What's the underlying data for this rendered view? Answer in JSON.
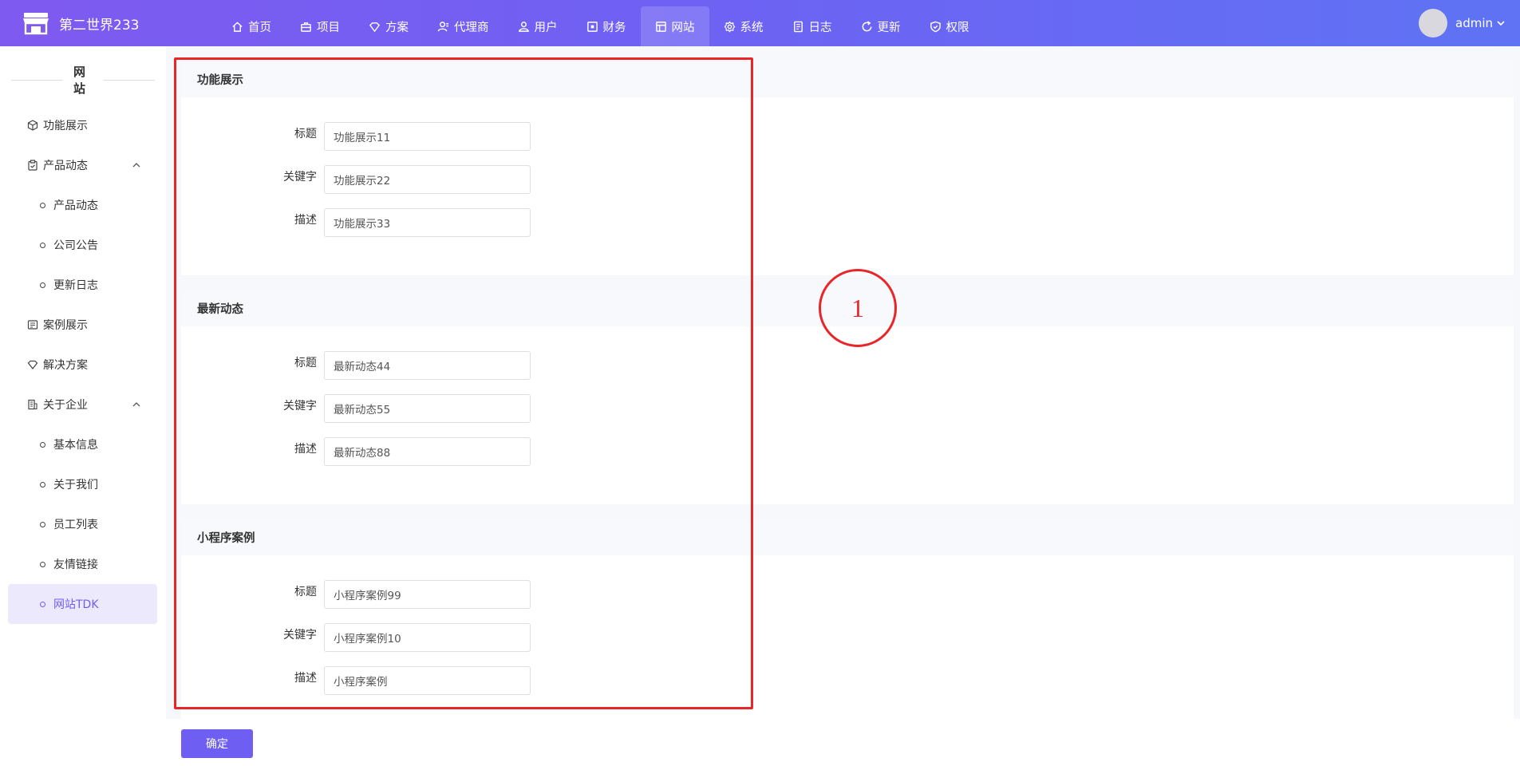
{
  "header": {
    "brand": "第二世界233",
    "nav": [
      {
        "label": "首页",
        "icon": "home-icon"
      },
      {
        "label": "项目",
        "icon": "briefcase-icon"
      },
      {
        "label": "方案",
        "icon": "diamond-icon"
      },
      {
        "label": "代理商",
        "icon": "agent-icon"
      },
      {
        "label": "用户",
        "icon": "users-icon"
      },
      {
        "label": "财务",
        "icon": "finance-icon"
      },
      {
        "label": "网站",
        "icon": "website-icon",
        "active": true
      },
      {
        "label": "系统",
        "icon": "gear-icon"
      },
      {
        "label": "日志",
        "icon": "log-icon"
      },
      {
        "label": "更新",
        "icon": "refresh-icon"
      },
      {
        "label": "权限",
        "icon": "shield-icon"
      }
    ],
    "user": "admin"
  },
  "sidebar": {
    "title": "网站",
    "items": [
      {
        "label": "功能展示",
        "level": 1,
        "icon": "cube-icon"
      },
      {
        "label": "产品动态",
        "level": 1,
        "icon": "clipboard-icon",
        "expanded": true
      },
      {
        "label": "产品动态",
        "level": 2
      },
      {
        "label": "公司公告",
        "level": 2
      },
      {
        "label": "更新日志",
        "level": 2
      },
      {
        "label": "案例展示",
        "level": 1,
        "icon": "case-icon"
      },
      {
        "label": "解决方案",
        "level": 1,
        "icon": "diamond-icon"
      },
      {
        "label": "关于企业",
        "level": 1,
        "icon": "building-icon",
        "expanded": true
      },
      {
        "label": "基本信息",
        "level": 2
      },
      {
        "label": "关于我们",
        "level": 2
      },
      {
        "label": "员工列表",
        "level": 2
      },
      {
        "label": "友情链接",
        "level": 2
      },
      {
        "label": "网站TDK",
        "level": 2,
        "active": true
      }
    ]
  },
  "sections": [
    {
      "title": "功能展示",
      "fields": [
        {
          "label": "标题",
          "value": "功能展示11"
        },
        {
          "label": "关键字",
          "value": "功能展示22"
        },
        {
          "label": "描述",
          "value": "功能展示33"
        }
      ]
    },
    {
      "title": "最新动态",
      "fields": [
        {
          "label": "标题",
          "value": "最新动态44"
        },
        {
          "label": "关键字",
          "value": "最新动态55"
        },
        {
          "label": "描述",
          "value": "最新动态88"
        }
      ]
    },
    {
      "title": "小程序案例",
      "fields": [
        {
          "label": "标题",
          "value": "小程序案例99"
        },
        {
          "label": "关键字",
          "value": "小程序案例10"
        },
        {
          "label": "描述",
          "value": "小程序案例"
        }
      ]
    }
  ],
  "footer": {
    "confirm_label": "确定"
  },
  "annotation": {
    "marker": "1"
  },
  "colors": {
    "accent": "#6f5ef2",
    "annotation": "#e8262a"
  }
}
